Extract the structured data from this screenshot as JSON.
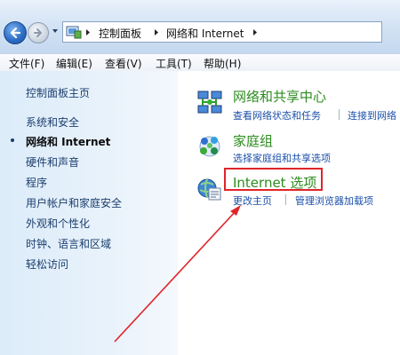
{
  "address": {
    "breadcrumbs": [
      "控制面板",
      "网络和 Internet"
    ]
  },
  "menu": [
    "文件(F)",
    "编辑(E)",
    "查看(V)",
    "工具(T)",
    "帮助(H)"
  ],
  "sidebar": {
    "home": "控制面板主页",
    "items": [
      {
        "label": "系统和安全",
        "current": false
      },
      {
        "label": "网络和 Internet",
        "current": true
      },
      {
        "label": "硬件和声音",
        "current": false
      },
      {
        "label": "程序",
        "current": false
      },
      {
        "label": "用户帐户和家庭安全",
        "current": false
      },
      {
        "label": "外观和个性化",
        "current": false
      },
      {
        "label": "时钟、语言和区域",
        "current": false
      },
      {
        "label": "轻松访问",
        "current": false
      }
    ]
  },
  "categories": [
    {
      "title": "网络和共享中心",
      "icon": "network-sharing-icon",
      "links": [
        "查看网络状态和任务",
        "连接到网络"
      ]
    },
    {
      "title": "家庭组",
      "icon": "homegroup-icon",
      "links": [
        "选择家庭组和共享选项"
      ]
    },
    {
      "title": "Internet 选项",
      "icon": "internet-options-icon",
      "links": [
        "更改主页",
        "管理浏览器加载项"
      ]
    }
  ],
  "colors": {
    "annotation_red": "#e0242a",
    "category_green": "#2c8b1e",
    "link_blue": "#1a4fa8"
  }
}
